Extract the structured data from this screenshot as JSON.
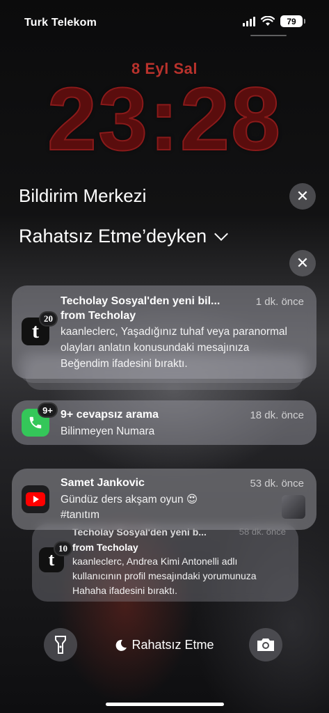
{
  "status": {
    "carrier": "Turk Telekom",
    "battery": "79"
  },
  "lock": {
    "date": "8 Eyl Sal",
    "time": "23:28"
  },
  "headers": {
    "notification_center": "Bildirim Merkezi",
    "focus": "Rahatsız Etme’deyken",
    "close_glyph": "✕"
  },
  "notifications": [
    {
      "app_icon": "techolay-icon",
      "badge": "20",
      "title": "Techolay Sosyal'den yeni bil...",
      "subtitle": "from Techolay",
      "time": "1 dk. önce",
      "body": "kaanleclerc, Yaşadığınız tuhaf veya paranormal olayları anlatın konusundaki mesajınıza Beğendim ifadesini bıraktı."
    },
    {
      "app_icon": "phone-icon",
      "badge": "9+",
      "title": "9+ cevapsız arama",
      "time": "18 dk. önce",
      "body": "Bilinmeyen Numara"
    },
    {
      "app_icon": "youtube-icon",
      "title": "Samet Jankovic",
      "time": "53 dk. önce",
      "body": "Gündüz ders akşam oyun 😍",
      "body2": "#tanıtım"
    },
    {
      "app_icon": "techolay-icon",
      "badge": "10",
      "title": "Techolay Sosyal'den yeni b...",
      "subtitle": "from Techolay",
      "time": "58 dk. önce",
      "body": "kaanleclerc, Andrea Kimi Antonelli adlı kullanıcının profil mesajındaki yorumunuza Hahaha ifadesini bıraktı."
    }
  ],
  "bottom": {
    "dnd_label": "Rahatsız Etme"
  }
}
